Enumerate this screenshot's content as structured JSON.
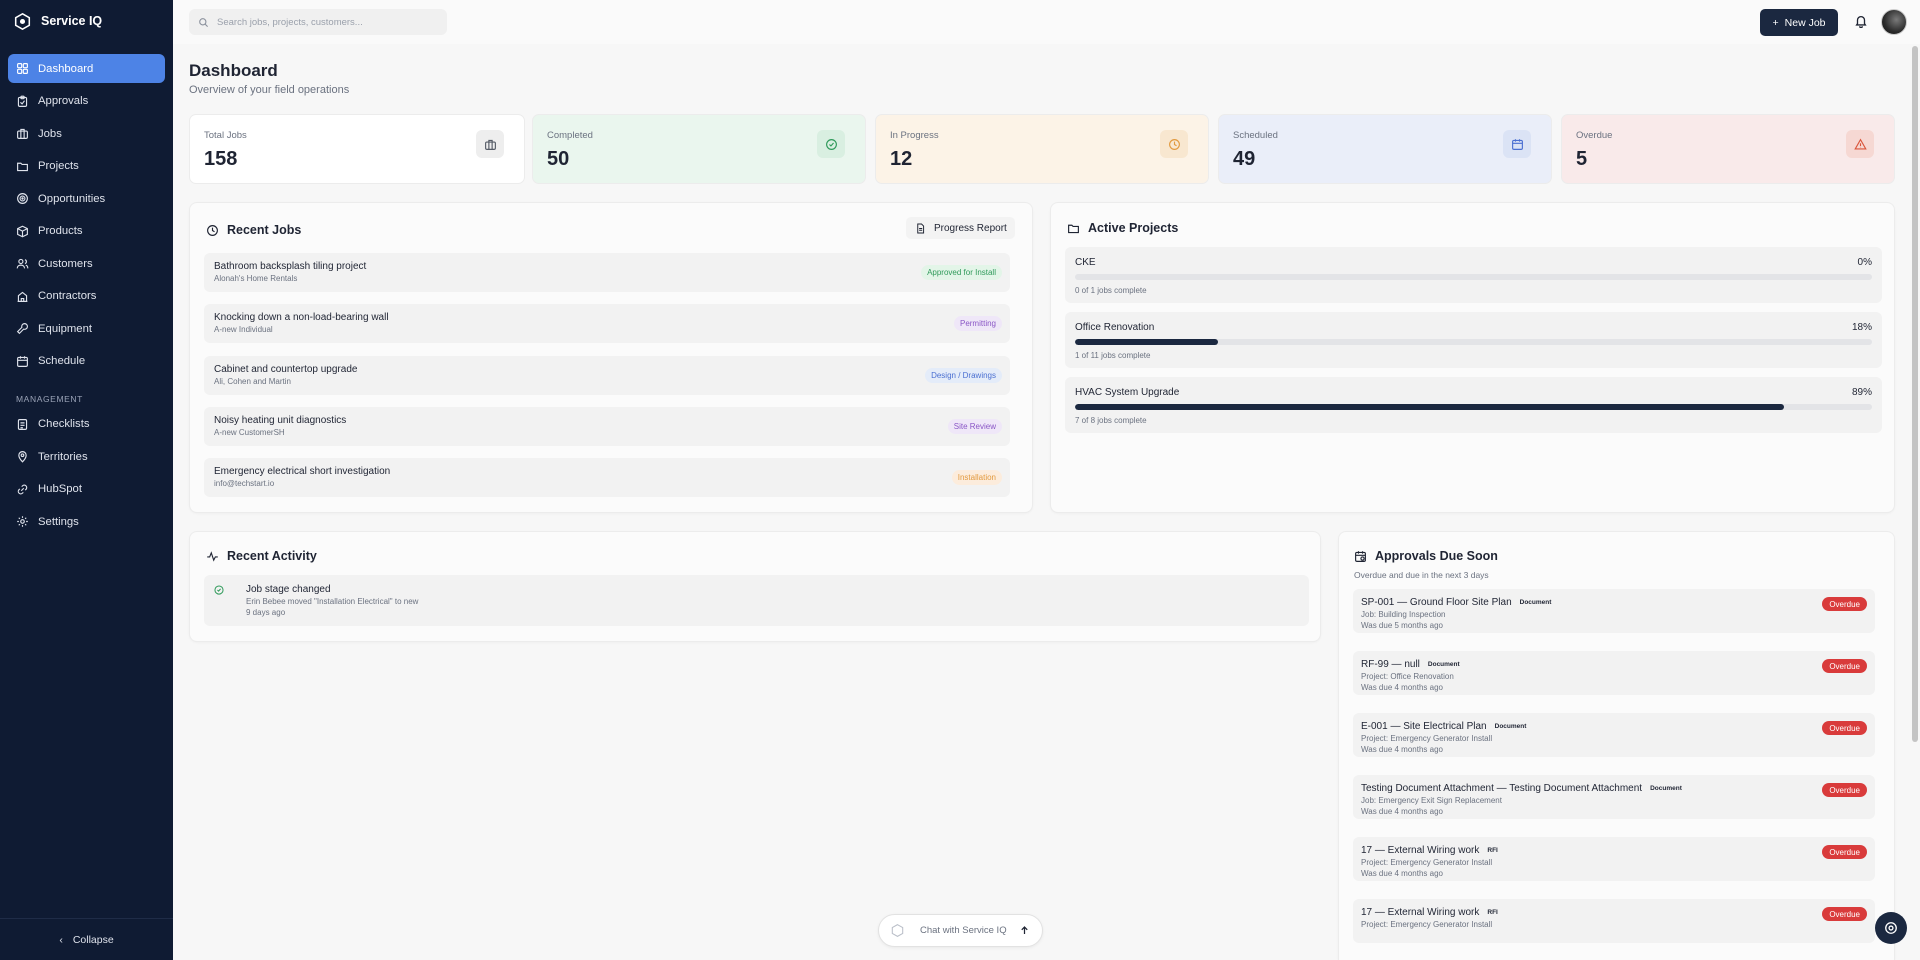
{
  "app": {
    "name": "Service IQ"
  },
  "sidebar": {
    "items": [
      {
        "label": "Dashboard",
        "icon": "dashboard-icon"
      },
      {
        "label": "Approvals",
        "icon": "clipboard-icon"
      },
      {
        "label": "Jobs",
        "icon": "briefcase-icon"
      },
      {
        "label": "Projects",
        "icon": "folder-icon"
      },
      {
        "label": "Opportunities",
        "icon": "target-icon"
      },
      {
        "label": "Products",
        "icon": "box-icon"
      },
      {
        "label": "Customers",
        "icon": "users-icon"
      },
      {
        "label": "Contractors",
        "icon": "building-icon"
      },
      {
        "label": "Equipment",
        "icon": "wrench-icon"
      },
      {
        "label": "Schedule",
        "icon": "calendar-icon"
      }
    ],
    "management_label": "MANAGEMENT",
    "management_items": [
      {
        "label": "Checklists",
        "icon": "checklist-icon"
      },
      {
        "label": "Territories",
        "icon": "map-pin-icon"
      },
      {
        "label": "HubSpot",
        "icon": "link-icon"
      },
      {
        "label": "Settings",
        "icon": "gear-icon"
      }
    ],
    "collapse_label": "Collapse"
  },
  "topbar": {
    "search_placeholder": "Search jobs, projects, customers...",
    "new_job_label": "New Job"
  },
  "dashboard": {
    "title": "Dashboard",
    "subtitle": "Overview of your field operations"
  },
  "stats": [
    {
      "label": "Total Jobs",
      "value": "158",
      "bg": "#ffffff",
      "icon_bg": "#eeeeee",
      "icon_color": "#555b66"
    },
    {
      "label": "Completed",
      "value": "50",
      "bg": "#eaf6ee",
      "icon_bg": "#d9efe1",
      "icon_color": "#2f9a5a"
    },
    {
      "label": "In Progress",
      "value": "12",
      "bg": "#fcf3e7",
      "icon_bg": "#f8e7d0",
      "icon_color": "#e29a3f"
    },
    {
      "label": "Scheduled",
      "value": "49",
      "bg": "#eaeef9",
      "icon_bg": "#dbe3f5",
      "icon_color": "#4a6fd1"
    },
    {
      "label": "Overdue",
      "value": "5",
      "bg": "#f9eaea",
      "icon_bg": "#f6d8d3",
      "icon_color": "#d9553b"
    }
  ],
  "recent_jobs": {
    "title": "Recent Jobs",
    "progress_report_label": "Progress Report",
    "rows": [
      {
        "title": "Bathroom backsplash tiling project",
        "subtitle": "Alonah's Home Rentals",
        "status": "Approved for Install",
        "status_bg": "#e3f5e8",
        "status_color": "#2f9a5a"
      },
      {
        "title": "Knocking down a non-load-bearing wall",
        "subtitle": "A-new Individual",
        "status": "Permitting",
        "status_bg": "#efe7f8",
        "status_color": "#8a56c6"
      },
      {
        "title": "Cabinet and countertop upgrade",
        "subtitle": "Ali, Cohen and Martin",
        "status": "Design / Drawings",
        "status_bg": "#e4ecf9",
        "status_color": "#4a6fd1"
      },
      {
        "title": "Noisy heating unit diagnostics",
        "subtitle": "A-new CustomerSH",
        "status": "Site Review",
        "status_bg": "#efe7f8",
        "status_color": "#8a56c6"
      },
      {
        "title": "Emergency electrical short investigation",
        "subtitle": "info@techstart.io",
        "status": "Installation",
        "status_bg": "#fcecdc",
        "status_color": "#e29a3f"
      }
    ]
  },
  "active_projects": {
    "title": "Active Projects",
    "rows": [
      {
        "name": "CKE",
        "percent": "0%",
        "progress": 0,
        "caption": "0 of 1 jobs complete"
      },
      {
        "name": "Office Renovation",
        "percent": "18%",
        "progress": 18,
        "caption": "1 of 11 jobs complete"
      },
      {
        "name": "HVAC System Upgrade",
        "percent": "89%",
        "progress": 89,
        "caption": "7 of 8 jobs complete"
      }
    ]
  },
  "recent_activity": {
    "title": "Recent Activity",
    "rows": [
      {
        "title": "Job stage changed",
        "detail": "Erin Bebee moved \"Installation Electrical\" to new",
        "time": "9 days ago"
      }
    ]
  },
  "approvals": {
    "title": "Approvals Due Soon",
    "subtitle": "Overdue and due in the next 3 days",
    "rows": [
      {
        "title": "SP-001 — Ground Floor Site Plan",
        "tag": "Document",
        "context": "Job: Building Inspection",
        "due": "Was due 5 months ago",
        "status": "Overdue"
      },
      {
        "title": "RF-99 — null",
        "tag": "Document",
        "context": "Project: Office Renovation",
        "due": "Was due 4 months ago",
        "status": "Overdue"
      },
      {
        "title": "E-001 — Site Electrical Plan",
        "tag": "Document",
        "context": "Project: Emergency Generator Install",
        "due": "Was due 4 months ago",
        "status": "Overdue"
      },
      {
        "title": "Testing Document Attachment — Testing Document Attachment",
        "tag": "Document",
        "context": "Job: Emergency Exit Sign Replacement",
        "due": "Was due 4 months ago",
        "status": "Overdue"
      },
      {
        "title": "17 — External Wiring work",
        "tag": "RFI",
        "context": "Project: Emergency Generator Install",
        "due": "Was due 4 months ago",
        "status": "Overdue"
      },
      {
        "title": "17 — External Wiring work",
        "tag": "RFI",
        "context": "Project: Emergency Generator Install",
        "due": "",
        "status": "Overdue"
      }
    ]
  },
  "chat": {
    "label": "Chat with Service IQ"
  },
  "colors": {
    "sidebar": "#0f1b33",
    "accent": "#4d83e6",
    "primary_button": "#1b2840",
    "overdue": "#d93b3b"
  }
}
